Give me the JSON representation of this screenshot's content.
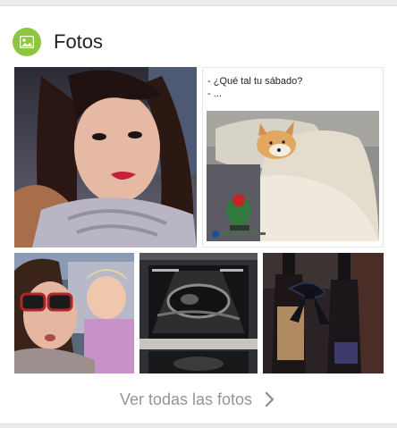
{
  "header": {
    "title": "Fotos",
    "icon": "photo-icon",
    "icon_color": "#8dc63f"
  },
  "meme": {
    "line1": "- ¿Qué tal tu sábado?",
    "line2": "- ..."
  },
  "photos": [
    {
      "name": "selfie-woman-red-lips"
    },
    {
      "name": "meme-dog-in-bed"
    },
    {
      "name": "car-selfie-with-child"
    },
    {
      "name": "ultrasound-image"
    },
    {
      "name": "wine-bottles-with-bow"
    }
  ],
  "footer": {
    "label": "Ver todas las fotos",
    "icon": "chevron-right-icon"
  }
}
